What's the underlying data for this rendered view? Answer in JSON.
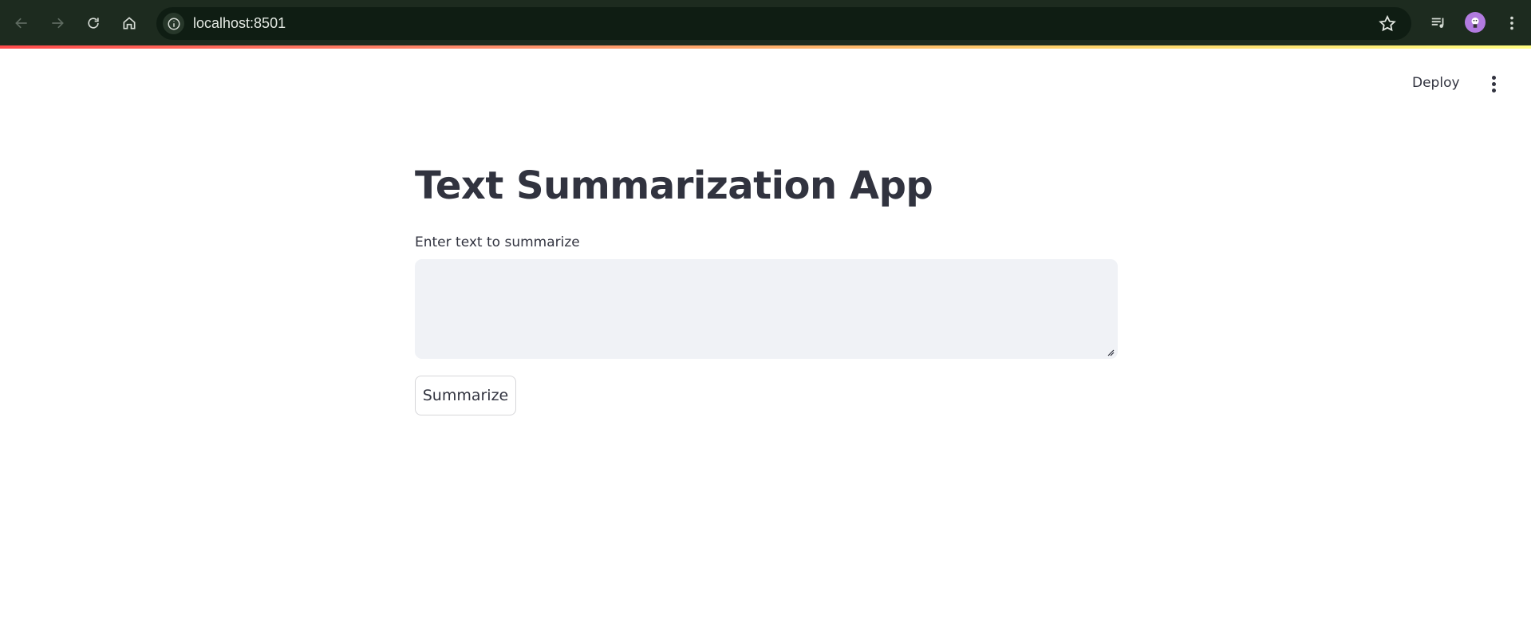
{
  "browser": {
    "url": "localhost:8501",
    "icons": [
      "back-icon",
      "forward-icon",
      "reload-icon",
      "home-icon",
      "site-info-icon",
      "bookmark-star-icon",
      "media-queue-icon",
      "profile-avatar",
      "browser-menu-icon"
    ]
  },
  "header": {
    "deploy_label": "Deploy",
    "menu_icon": "kebab-menu-icon"
  },
  "main": {
    "title": "Text Summarization App",
    "input_label": "Enter text to summarize",
    "input_value": "",
    "button_label": "Summarize"
  },
  "colors": {
    "chrome_bg": "#1d2b1f",
    "text": "#31333f",
    "textarea_bg": "#f0f2f6",
    "accent": "#ff4b4b"
  }
}
